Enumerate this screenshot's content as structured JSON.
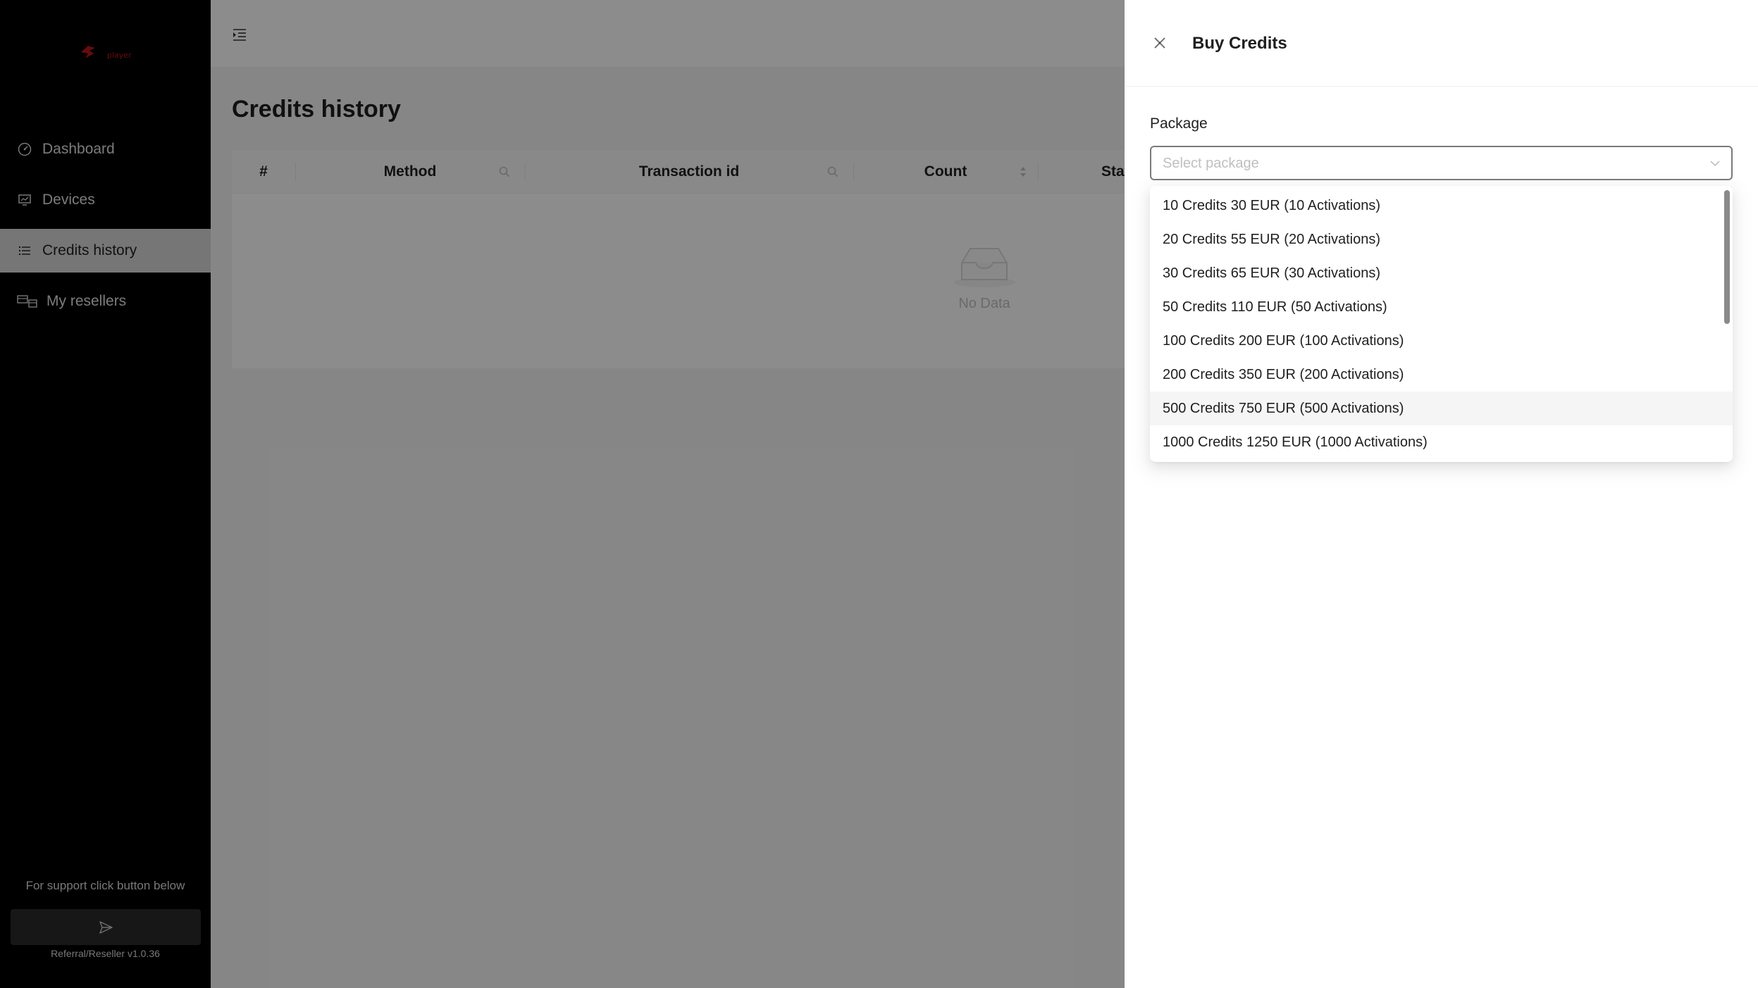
{
  "sidebar": {
    "logo_text": "player",
    "items": [
      {
        "label": "Dashboard",
        "icon": "dashboard-icon"
      },
      {
        "label": "Devices",
        "icon": "devices-icon"
      },
      {
        "label": "Credits history",
        "icon": "list-icon",
        "active": true
      },
      {
        "label": "My resellers",
        "icon": "resellers-icon"
      }
    ],
    "support_text": "For support click button below",
    "version": "Referral/Reseller v1.0.36"
  },
  "page": {
    "title": "Credits history",
    "table": {
      "columns": [
        "#",
        "Method",
        "Transaction id",
        "Count",
        "Stat"
      ],
      "empty_text": "No Data"
    }
  },
  "drawer": {
    "title": "Buy Credits",
    "field_label": "Package",
    "select_placeholder": "Select package",
    "options": [
      "10 Credits 30 EUR (10 Activations)",
      "20 Credits 55 EUR (20 Activations)",
      "30 Credits 65 EUR (30 Activations)",
      "50 Credits 110 EUR (50 Activations)",
      "100 Credits 200 EUR (100 Activations)",
      "200 Credits 350 EUR (200 Activations)",
      "500 Credits 750 EUR (500 Activations)",
      "1000 Credits 1250 EUR (1000 Activations)"
    ],
    "hovered_option_index": 6
  },
  "colors": {
    "sidebar_bg": "#000000",
    "brand_red": "#b8141a",
    "active_item_bg": "#d8d8d8",
    "mask": "rgba(0,0,0,0.45)"
  }
}
